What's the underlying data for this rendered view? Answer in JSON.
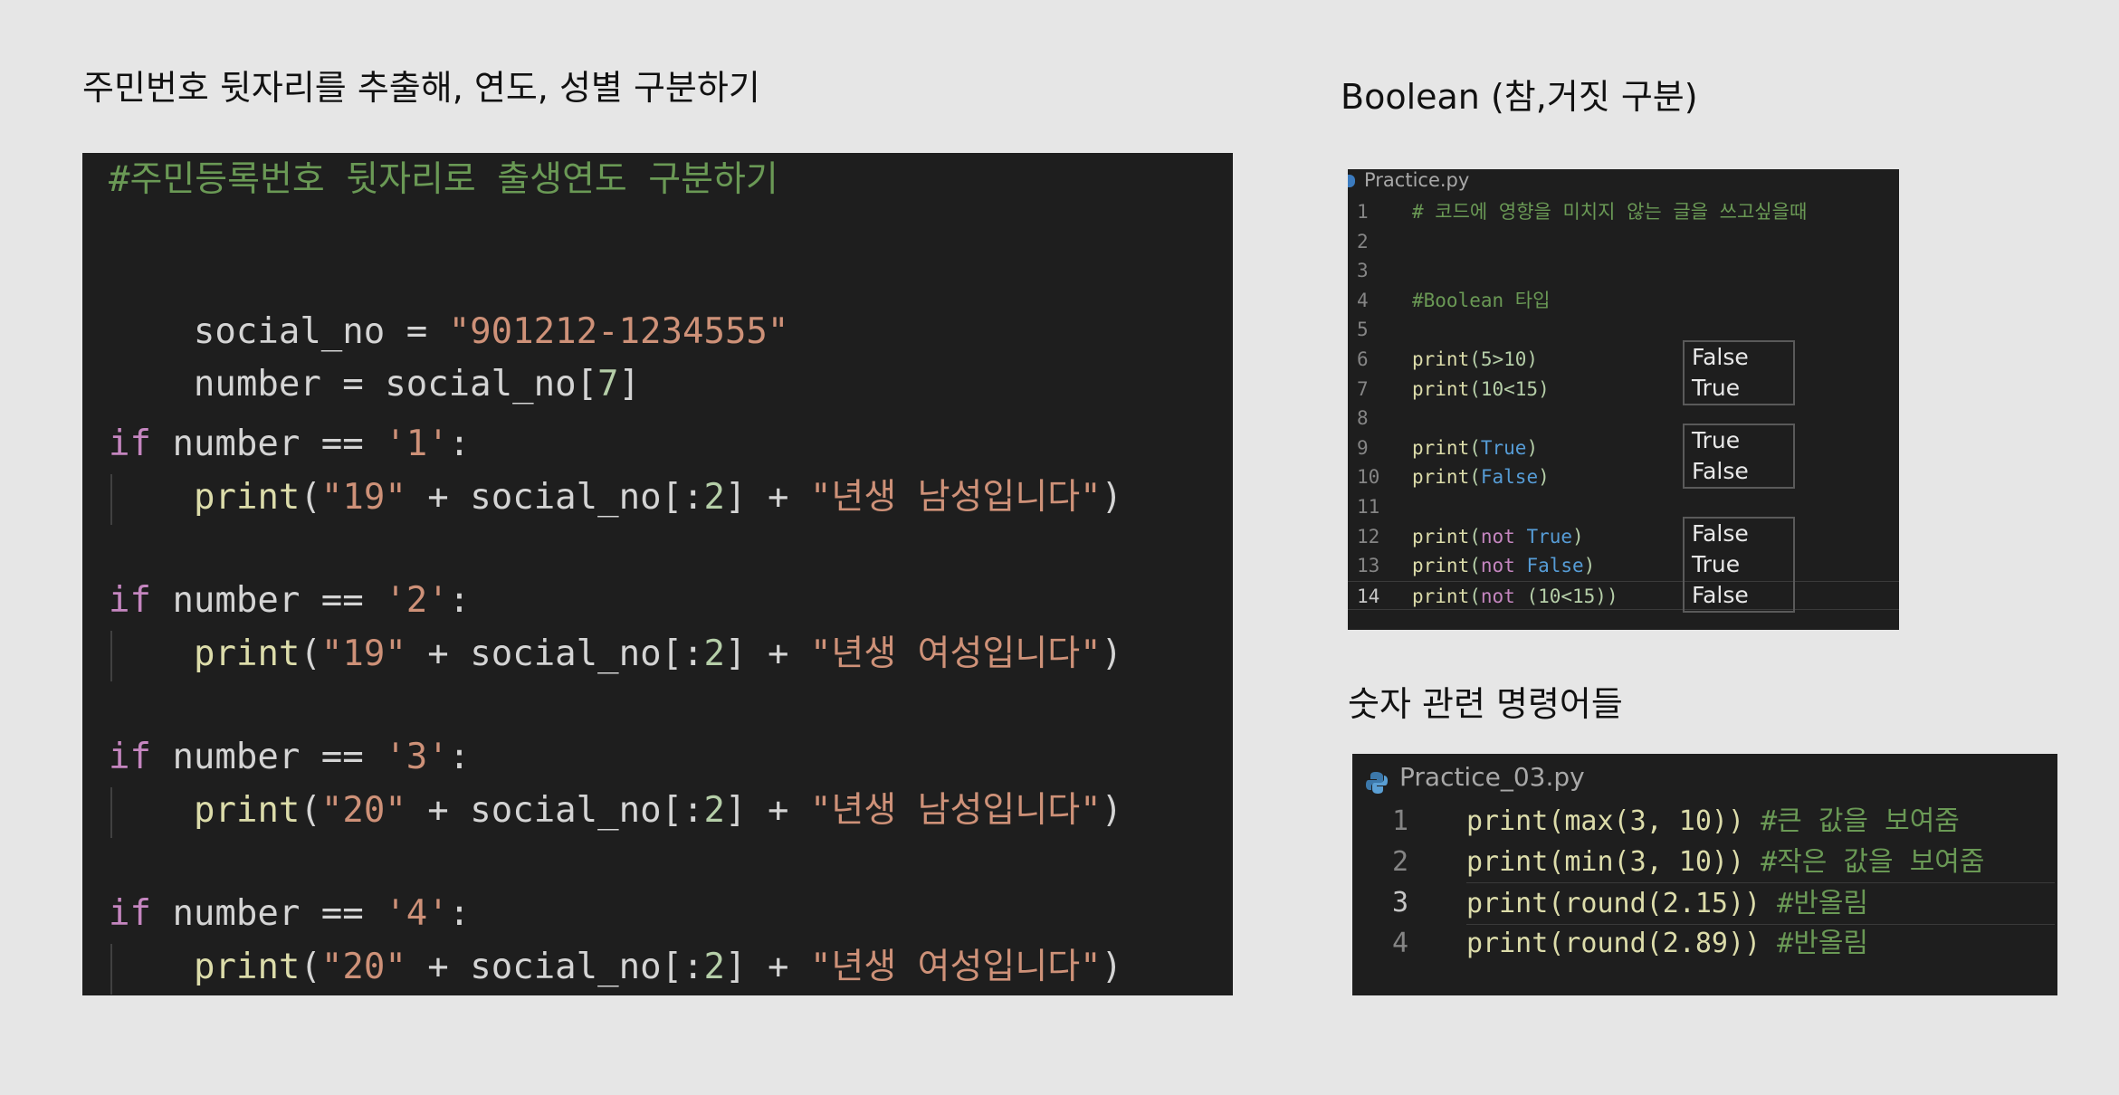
{
  "headings": {
    "main": "주민번호 뒷자리를 추출해, 연도, 성별 구분하기",
    "boolean": "Boolean (참,거짓 구분)",
    "numbers": "숫자 관련 명령어들"
  },
  "main_code": {
    "comment": "#주민등록번호 뒷자리로 출생연도 구분하기",
    "assign1_var": "social_no",
    "assign1_op": " = ",
    "assign1_val": "\"901212-1234555\"",
    "assign2_a": "number = social_no[",
    "assign2_idx": "7",
    "assign2_b": "]",
    "kw_if": "if",
    "cond_a": " number == ",
    "cond_colon": ":",
    "blocks": [
      {
        "cmp": "'1'",
        "year": "\"19\"",
        "msg": "\"년생 남성입니다\""
      },
      {
        "cmp": "'2'",
        "year": "\"19\"",
        "msg": "\"년생 여성입니다\""
      },
      {
        "cmp": "'3'",
        "year": "\"20\"",
        "msg": "\"년생 남성입니다\""
      },
      {
        "cmp": "'4'",
        "year": "\"20\"",
        "msg": "\"년생 여성입니다\""
      }
    ],
    "print_fn": "print",
    "print_open": "(",
    "print_mid_a": " + social_no[:",
    "print_slice": "2",
    "print_mid_b": "] + ",
    "print_close": ")"
  },
  "bool_panel": {
    "tab": "Practice.py",
    "lines": [
      {
        "n": "1",
        "comment": "# 코드에 영향을 미치지 않는 글을 쓰고싶을때"
      },
      {
        "n": "2"
      },
      {
        "n": "3"
      },
      {
        "n": "4",
        "comment": "#Boolean 타입"
      },
      {
        "n": "5"
      },
      {
        "n": "6",
        "fn": "print",
        "a": "(5>10)"
      },
      {
        "n": "7",
        "fn": "print",
        "a": "(10<15)"
      },
      {
        "n": "8"
      },
      {
        "n": "9",
        "fn": "print",
        "a": "(",
        "const": "True",
        "b": ")"
      },
      {
        "n": "10",
        "fn": "print",
        "a": "(",
        "const": "False",
        "b": ")"
      },
      {
        "n": "11"
      },
      {
        "n": "12",
        "fn": "print",
        "a": "(",
        "kw": "not ",
        "const": "True",
        "b": ")"
      },
      {
        "n": "13",
        "fn": "print",
        "a": "(",
        "kw": "not ",
        "const": "False",
        "b": ")"
      },
      {
        "n": "14",
        "fn": "print",
        "a": "(",
        "kw": "not ",
        "b": "(10<15))"
      }
    ],
    "outputs": [
      [
        "False",
        "True"
      ],
      [
        "True",
        "False"
      ],
      [
        "False",
        "True",
        "False"
      ]
    ]
  },
  "num_panel": {
    "tab": "Practice_03.py",
    "lines": [
      {
        "n": "1",
        "code": "print(max(3, 10))",
        "comment": "#큰 값을 보여줌"
      },
      {
        "n": "2",
        "code": "print(min(3, 10))",
        "comment": "#작은 값을 보여줌"
      },
      {
        "n": "3",
        "code": "print(round(2.15))",
        "comment": "#반올림"
      },
      {
        "n": "4",
        "code": "print(round(2.89))",
        "comment": "#반올림"
      }
    ]
  },
  "colors": {
    "editor_bg": "#1e1e1e",
    "page_bg": "#e6e6e6",
    "comment": "#6a9955",
    "string": "#ce9178",
    "number": "#b5cea8",
    "keyword": "#c586c0",
    "function": "#dcdcaa",
    "constant": "#569cd6"
  }
}
